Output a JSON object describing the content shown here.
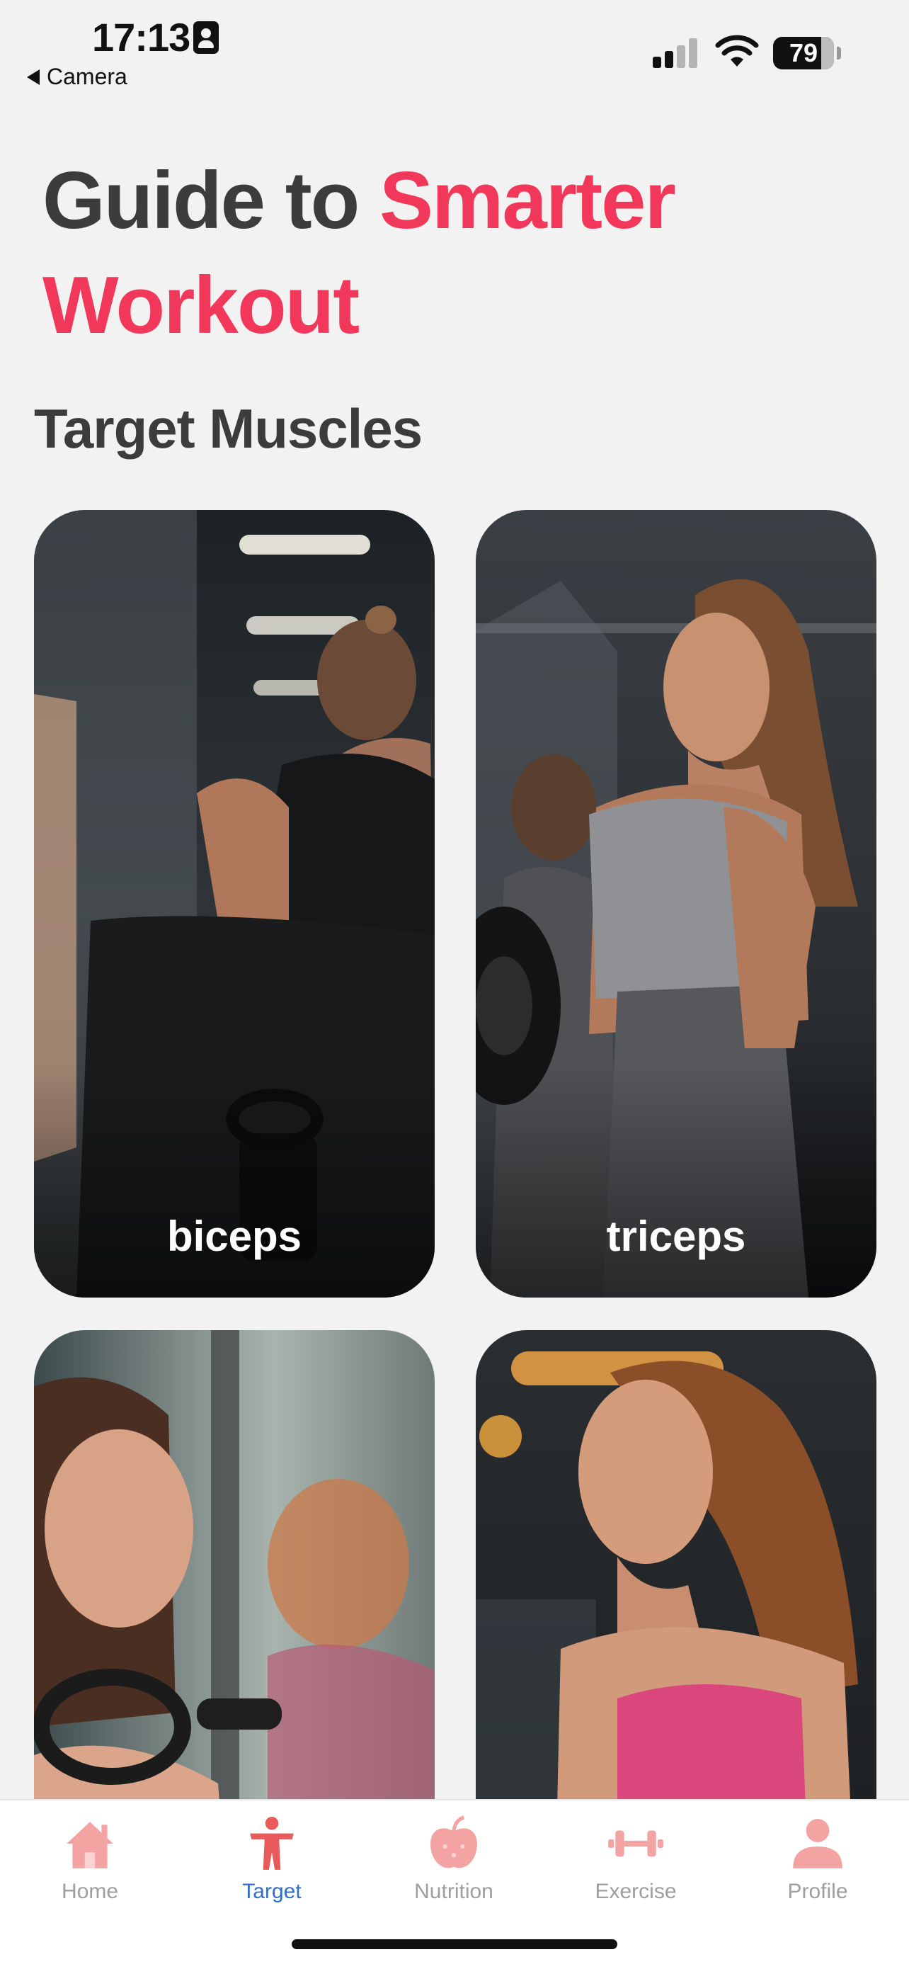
{
  "status_bar": {
    "time": "17:13",
    "back_app": "Camera",
    "battery": "79"
  },
  "header": {
    "title_part1": "Guide to ",
    "title_part2": "Smarter Workout"
  },
  "section_title": "Target Muscles",
  "cards": [
    {
      "label": "biceps"
    },
    {
      "label": "triceps"
    },
    {
      "label": ""
    },
    {
      "label": ""
    }
  ],
  "tabbar": {
    "items": [
      {
        "label": "Home",
        "icon": "house-icon"
      },
      {
        "label": "Target",
        "icon": "person-icon",
        "active": true
      },
      {
        "label": "Nutrition",
        "icon": "apple-icon"
      },
      {
        "label": "Exercise",
        "icon": "dumbbell-icon"
      },
      {
        "label": "Profile",
        "icon": "profile-icon"
      }
    ]
  },
  "colors": {
    "accent": "#f2385a",
    "tab_active": "#2f6fc9",
    "tab_icon": "#f4a3a3",
    "tab_icon_active": "#e95a5a"
  }
}
